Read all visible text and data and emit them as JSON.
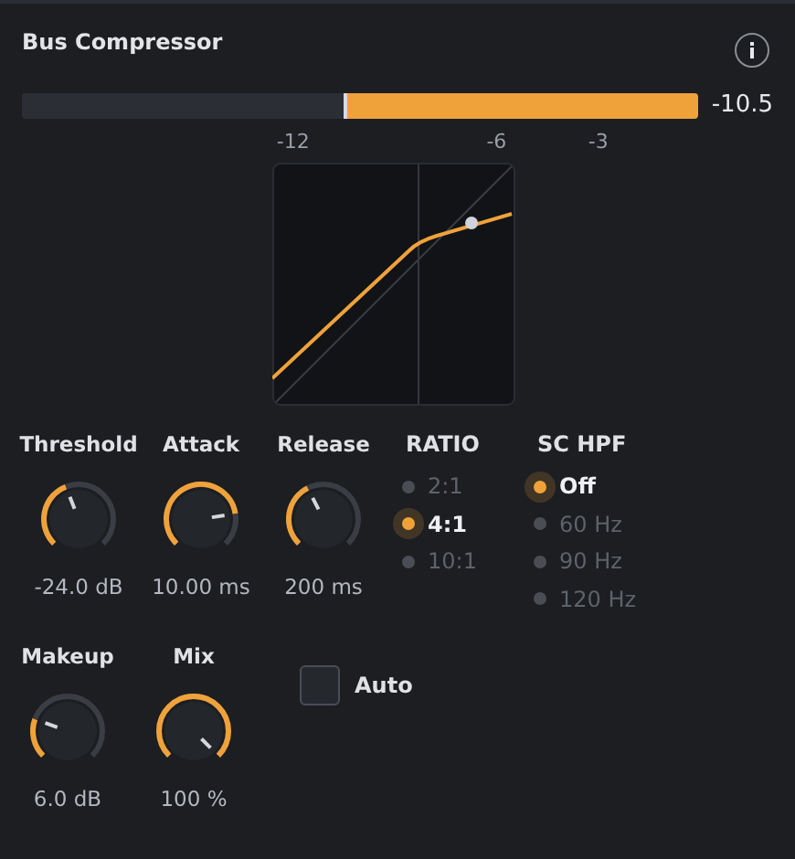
{
  "title": "Bus Compressor",
  "meter": {
    "level": 0.526,
    "reading": "-10.5",
    "ticks": [
      "-12",
      "-6",
      "-3"
    ]
  },
  "knobs_row_1": [
    {
      "label": "Threshold",
      "reading": "-24.0 dB"
    },
    {
      "label": "Attack",
      "reading": "10.00 ms"
    },
    {
      "label": "Release",
      "reading": "200 ms"
    }
  ],
  "ratio": {
    "label": "RATIO",
    "options": [
      {
        "label": "2:1",
        "selected": false
      },
      {
        "label": "4:1",
        "selected": true
      },
      {
        "label": "10:1",
        "selected": false
      }
    ]
  },
  "sc_hpf": {
    "label": "SC HPF",
    "options": [
      {
        "label": "Off",
        "selected": true
      },
      {
        "label": "60 Hz",
        "selected": false
      },
      {
        "label": "90 Hz",
        "selected": false
      },
      {
        "label": "120 Hz",
        "selected": false
      }
    ]
  },
  "knobs_row_2": [
    {
      "label": "Makeup",
      "reading": "6.0 dB"
    },
    {
      "label": "Mix",
      "reading": "100 %"
    }
  ],
  "auto": {
    "label": "Auto",
    "checked": false
  }
}
